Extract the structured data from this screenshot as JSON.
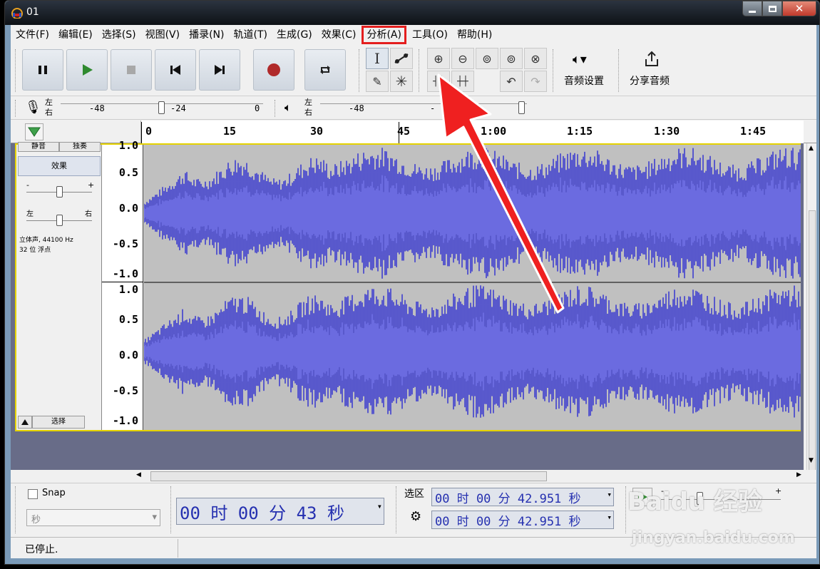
{
  "window": {
    "title": "01",
    "controls": [
      "minimize",
      "maximize",
      "close"
    ]
  },
  "menu": {
    "items": [
      {
        "label": "文件(F)"
      },
      {
        "label": "编辑(E)"
      },
      {
        "label": "选择(S)"
      },
      {
        "label": "视图(V)"
      },
      {
        "label": "播录(N)"
      },
      {
        "label": "轨道(T)"
      },
      {
        "label": "生成(G)"
      },
      {
        "label": "效果(C)"
      },
      {
        "label": "分析(A)",
        "highlighted": true
      },
      {
        "label": "工具(O)"
      },
      {
        "label": "帮助(H)"
      }
    ]
  },
  "toolbar": {
    "audio_setup_label": "音频设置",
    "share_audio_label": "分享音频",
    "colors": {
      "record": "#b02a2a",
      "play": "#2f8a2f"
    }
  },
  "meters": {
    "record_left_right": [
      "左",
      "右"
    ],
    "record_ticks": [
      "-48",
      "-24",
      "0"
    ],
    "play_left_right": [
      "左",
      "右"
    ],
    "play_ticks": [
      "-48",
      "-"
    ]
  },
  "timeline": {
    "labels": [
      "0",
      "15",
      "30",
      "45",
      "1:00",
      "1:15",
      "1:30",
      "1:45"
    ]
  },
  "track": {
    "buttons_top": [
      "静音",
      "独奏"
    ],
    "effects_label": "效果",
    "gain_minus": "-",
    "gain_plus": "+",
    "pan_left": "左",
    "pan_right": "右",
    "info_line1": "立体声, 44100 Hz",
    "info_line2": "32 位 浮点",
    "select_label": "选择",
    "ruler_top": [
      "1.0",
      "0.5",
      "0.0",
      "-0.5",
      "-1.0"
    ],
    "ruler_bottom": [
      "1.0",
      "0.5",
      "0.0",
      "-0.5",
      "-1.0"
    ],
    "wave_color": "#3f3fcf",
    "wave_rms_color": "#6b6be0"
  },
  "bottom": {
    "snap_label": "Snap",
    "snap_unit": "秒",
    "audio_position": "00 时 00 分 43 秒",
    "selection_label": "选区",
    "selection_start": "00 时 00 分 42.951 秒",
    "selection_end": "00 时 00 分 42.951 秒",
    "speed_minus": "-",
    "speed_plus": "+"
  },
  "status": {
    "text": "已停止."
  },
  "watermark": {
    "brand": "Baidu 经验",
    "url": "jingyan.baidu.com"
  }
}
